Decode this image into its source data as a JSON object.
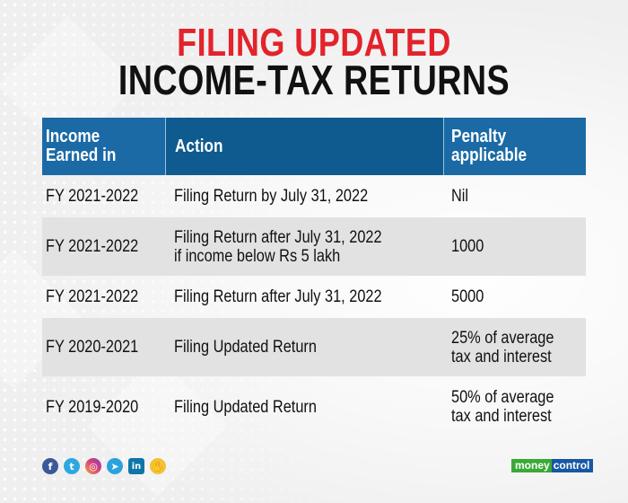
{
  "title": {
    "line1": "FILING UPDATED",
    "line2": "INCOME-TAX RETURNS",
    "accent_color": "#e3232b"
  },
  "table": {
    "headers": [
      "Income Earned in",
      "Action",
      "Penalty applicable"
    ],
    "header_lines": [
      [
        "Income",
        "Earned in"
      ],
      [
        "Action"
      ],
      [
        "Penalty",
        "applicable"
      ]
    ],
    "rows": [
      {
        "income": "FY 2021-2022",
        "action": [
          "Filing Return by July 31, 2022"
        ],
        "penalty": [
          "Nil"
        ]
      },
      {
        "income": "FY 2021-2022",
        "action": [
          "Filing Return after July 31, 2022",
          "if income below Rs 5 lakh"
        ],
        "penalty": [
          "1000"
        ]
      },
      {
        "income": "FY 2021-2022",
        "action": [
          "Filing Return after July 31, 2022"
        ],
        "penalty": [
          "5000"
        ]
      },
      {
        "income": "FY 2020-2021",
        "action": [
          "Filing Updated Return"
        ],
        "penalty": [
          "25% of average",
          "tax and interest"
        ]
      },
      {
        "income": "FY 2019-2020",
        "action": [
          "Filing Updated Return"
        ],
        "penalty": [
          "50% of average",
          "tax and interest"
        ]
      }
    ],
    "header_colors": {
      "light": "#1b6aa6",
      "dark": "#0f5b8f"
    }
  },
  "footer": {
    "social_icons": [
      {
        "name": "facebook-icon",
        "glyph": "f"
      },
      {
        "name": "twitter-icon",
        "glyph": "t"
      },
      {
        "name": "instagram-icon",
        "glyph": "◎"
      },
      {
        "name": "telegram-icon",
        "glyph": "➤"
      },
      {
        "name": "linkedin-icon",
        "glyph": "in"
      },
      {
        "name": "koo-icon",
        "glyph": "✋"
      }
    ],
    "brand": {
      "part1": "money",
      "part2": "control"
    }
  }
}
